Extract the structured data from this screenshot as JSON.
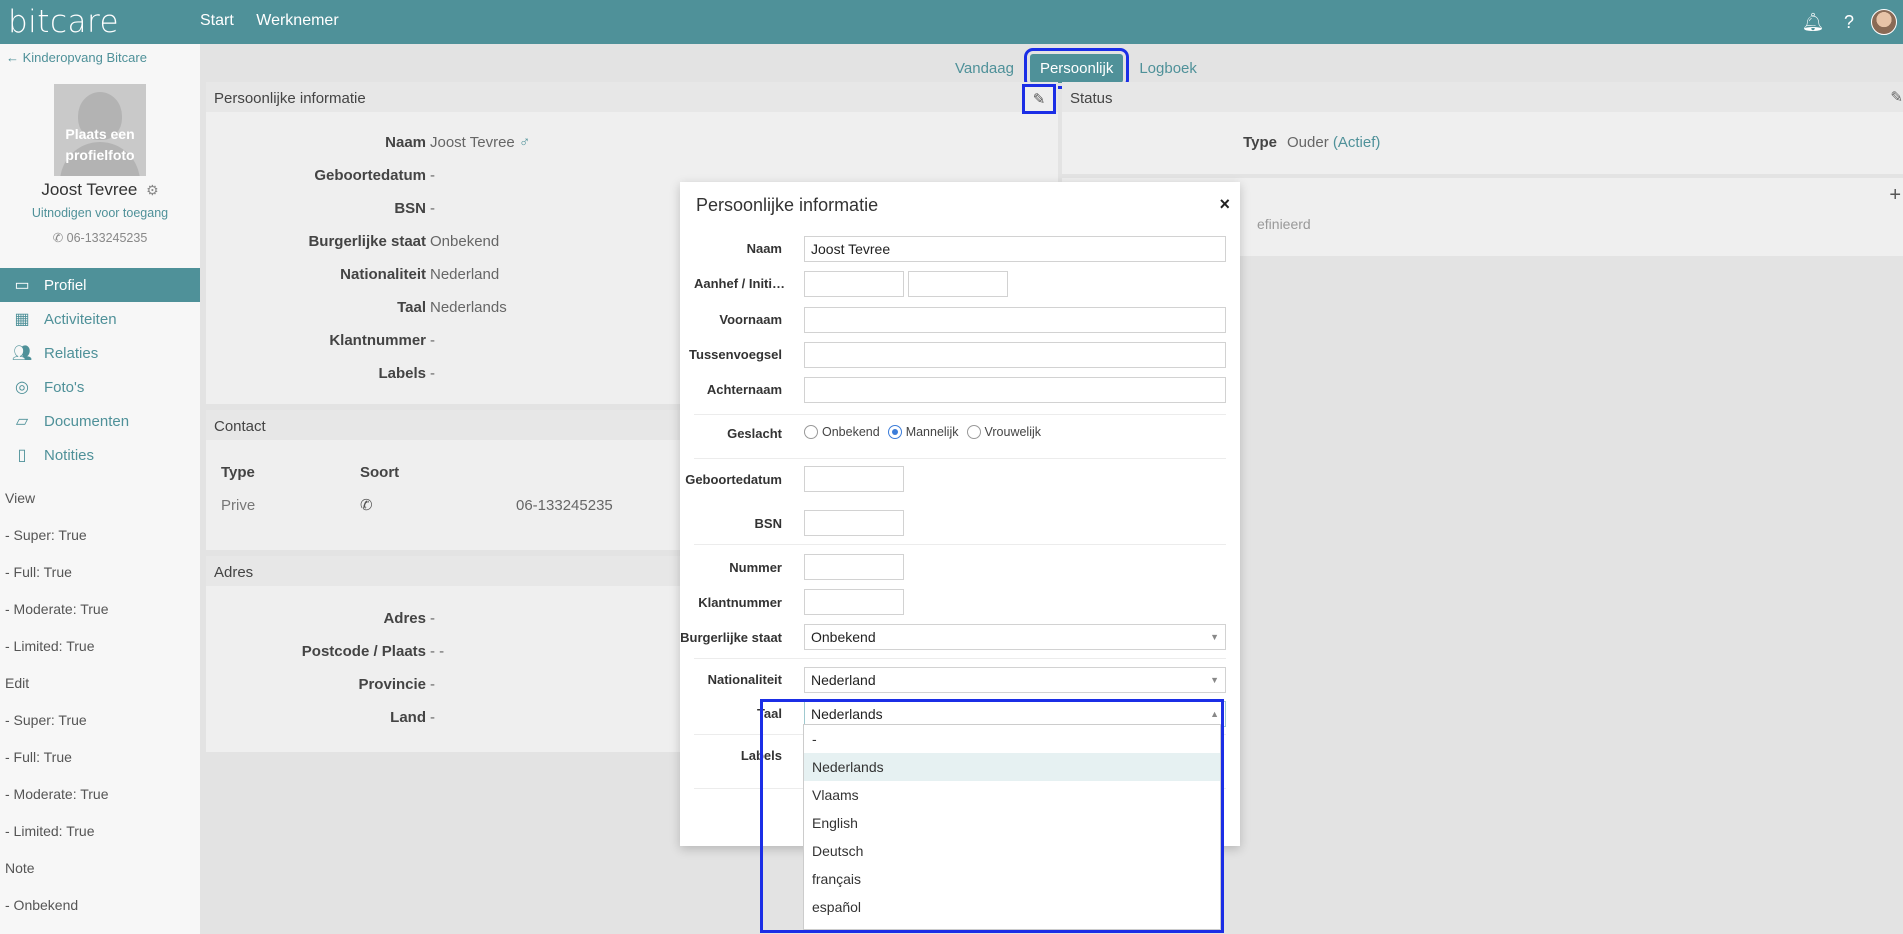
{
  "topbar": {
    "logo": "bitcare",
    "nav": [
      "Start",
      "Werknemer"
    ],
    "icons": [
      "bell-icon",
      "help-icon",
      "avatar"
    ]
  },
  "sidebar": {
    "back_link": "Kinderopvang Bitcare",
    "photo_text_1": "Plaats een",
    "photo_text_2": "profielfoto",
    "name": "Joost Tevree",
    "invite": "Uitnodigen voor toegang",
    "phone": "06-133245235",
    "nav": [
      {
        "label": "Profiel",
        "icon": "profile-card-icon"
      },
      {
        "label": "Activiteiten",
        "icon": "table-icon"
      },
      {
        "label": "Relaties",
        "icon": "people-icon"
      },
      {
        "label": "Foto's",
        "icon": "camera-icon"
      },
      {
        "label": "Documenten",
        "icon": "folder-icon"
      },
      {
        "label": "Notities",
        "icon": "clipboard-icon"
      }
    ],
    "permissions": [
      "View",
      "- Super: True",
      "- Full: True",
      "- Moderate: True",
      "- Limited: True",
      "Edit",
      "- Super: True",
      "- Full: True",
      "- Moderate: True",
      "- Limited: True",
      "Note",
      "- Onbekend"
    ]
  },
  "tabs": [
    "Vandaag",
    "Persoonlijk",
    "Logboek"
  ],
  "personal_panel": {
    "title": "Persoonlijke informatie",
    "rows": [
      {
        "k": "Naam",
        "v": "Joost Tevree"
      },
      {
        "k": "Geboortedatum",
        "v": "-"
      },
      {
        "k": "BSN",
        "v": "-"
      },
      {
        "k": "Burgerlijke staat",
        "v": "Onbekend"
      },
      {
        "k": "Nationaliteit",
        "v": "Nederland"
      },
      {
        "k": "Taal",
        "v": "Nederlands"
      },
      {
        "k": "Klantnummer",
        "v": "-"
      },
      {
        "k": "Labels",
        "v": "-"
      }
    ]
  },
  "contact_panel": {
    "title": "Contact",
    "col_type": "Type",
    "col_soort": "Soort",
    "type": "Prive",
    "number": "06-133245235"
  },
  "address_panel": {
    "title": "Adres",
    "rows": [
      {
        "k": "Adres",
        "v": "-"
      },
      {
        "k": "Postcode / Plaats",
        "v": "- -"
      },
      {
        "k": "Provincie",
        "v": "-"
      },
      {
        "k": "Land",
        "v": "-"
      }
    ]
  },
  "status_panel": {
    "title": "Status",
    "type_label": "Type",
    "type_value": "Ouder",
    "type_status": "(Actief)",
    "partial_text": "efinieerd"
  },
  "modal": {
    "title": "Persoonlijke informatie",
    "close": "×",
    "labels": {
      "naam": "Naam",
      "aanhef": "Aanhef / Initia…",
      "voornaam": "Voornaam",
      "tussenvoegsel": "Tussenvoegsel",
      "achternaam": "Achternaam",
      "geslacht": "Geslacht",
      "geboortedatum": "Geboortedatum",
      "bsn": "BSN",
      "nummer": "Nummer",
      "klantnummer": "Klantnummer",
      "burgerlijke_staat": "Burgerlijke staat",
      "nationaliteit": "Nationaliteit",
      "taal": "Taal",
      "labels": "Labels"
    },
    "values": {
      "naam": "Joost Tevree",
      "burgerlijke_staat": "Onbekend",
      "nationaliteit": "Nederland",
      "taal": "Nederlands"
    },
    "gender_options": [
      "Onbekend",
      "Mannelijk",
      "Vrouwelijk"
    ],
    "gender_selected": "Mannelijk",
    "language_options": [
      "-",
      "Nederlands",
      "Vlaams",
      "English",
      "Deutsch",
      "français",
      "español"
    ],
    "language_selected": "Nederlands"
  },
  "colors": {
    "brand": "#4f9199",
    "highlight_frame": "#1b2ee6"
  }
}
